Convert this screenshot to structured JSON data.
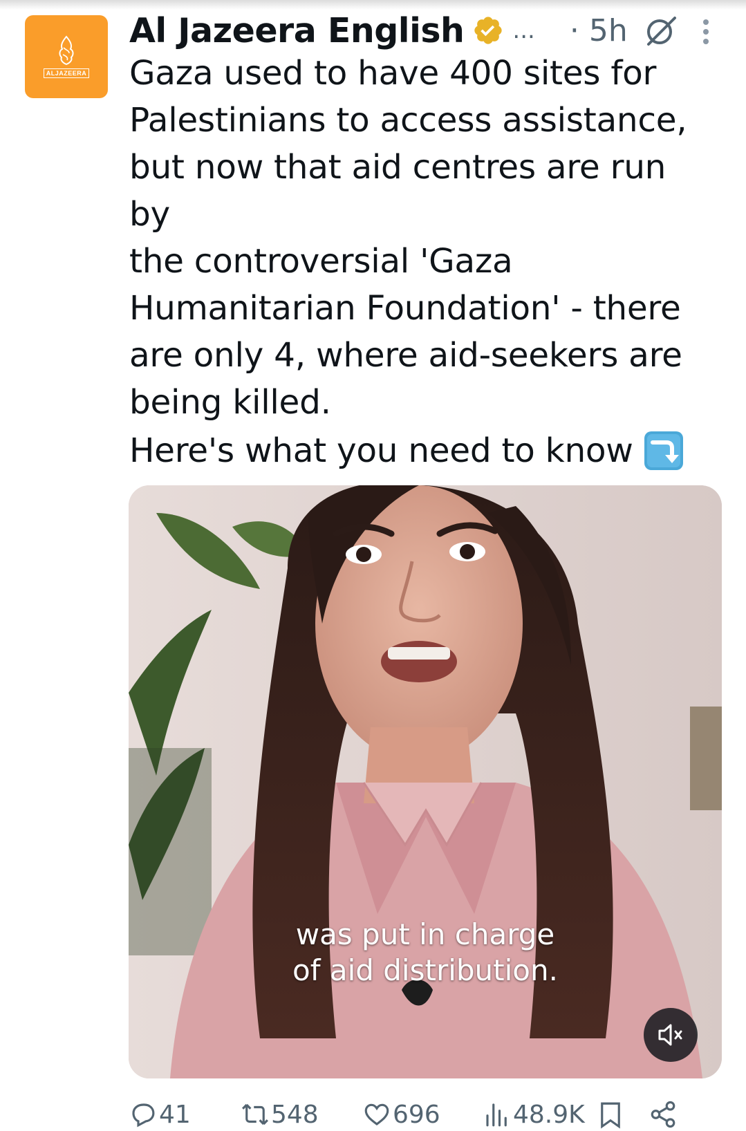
{
  "author": {
    "name": "Al Jazeera English",
    "logo_text": "ALJAZEERA",
    "verified_color": "#e8b227",
    "avatar_color": "#fa9d2a"
  },
  "header": {
    "overflow": "...",
    "time": "· 5h",
    "grok_icon": "grok-icon",
    "more_icon": "more-vertical-icon"
  },
  "tweet": {
    "text": "Gaza used to have 400 sites for\nPalestinians to access assistance,\nbut now that aid centres are run by\nthe controversial 'Gaza\nHumanitarian Foundation' - there\nare only 4, where aid-seekers are\nbeing killed.",
    "tail": "Here's what you need to know",
    "tail_emoji": "right-arrow-curving-down-emoji"
  },
  "media": {
    "caption": "was put in charge\nof aid distribution.",
    "mute_icon": "volume-muted-icon"
  },
  "actions": {
    "replies": "41",
    "reposts": "548",
    "likes": "696",
    "views": "48.9K",
    "accent": "#536471"
  }
}
